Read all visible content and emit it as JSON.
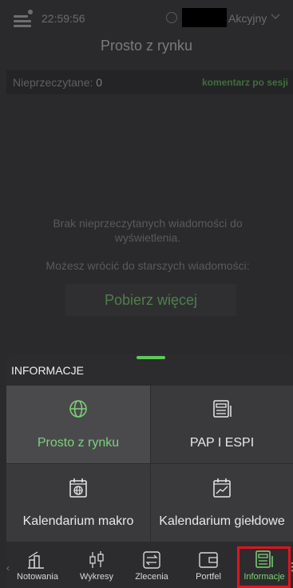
{
  "status": {
    "time": "22:59:56",
    "account_type": "Akcyjny"
  },
  "header": {
    "title": "Prosto z rynku"
  },
  "infobar": {
    "unread_label": "Nieprzeczytane:",
    "unread_count": "0",
    "comment_link": "komentarz po sesji"
  },
  "empty_state": {
    "message": "Brak nieprzeczytanych wiadomości do wyświetlenia.",
    "older_hint": "Możesz wrócić do starszych wiadomości:",
    "more_button": "Pobierz więcej"
  },
  "sheet": {
    "title": "INFORMACJE",
    "tiles": [
      {
        "label": "Prosto z rynku",
        "icon": "globe-icon",
        "active": true
      },
      {
        "label": "PAP I ESPI",
        "icon": "newspaper-icon",
        "active": false
      },
      {
        "label": "Kalendarium makro",
        "icon": "calendar-globe-icon",
        "active": false
      },
      {
        "label": "Kalendarium giełdowe",
        "icon": "calendar-chart-icon",
        "active": false
      }
    ]
  },
  "nav": {
    "items": [
      {
        "label": "Notowania",
        "icon": "bar-chart-icon"
      },
      {
        "label": "Wykresy",
        "icon": "candlestick-icon"
      },
      {
        "label": "Zlecenia",
        "icon": "exchange-icon"
      },
      {
        "label": "Portfel",
        "icon": "wallet-icon"
      },
      {
        "label": "Informacje",
        "icon": "newspaper-icon",
        "active": true
      }
    ]
  },
  "colors": {
    "accent_green": "#7ed17a",
    "highlight_red": "#e1141b",
    "background": "#2a2a2c"
  }
}
